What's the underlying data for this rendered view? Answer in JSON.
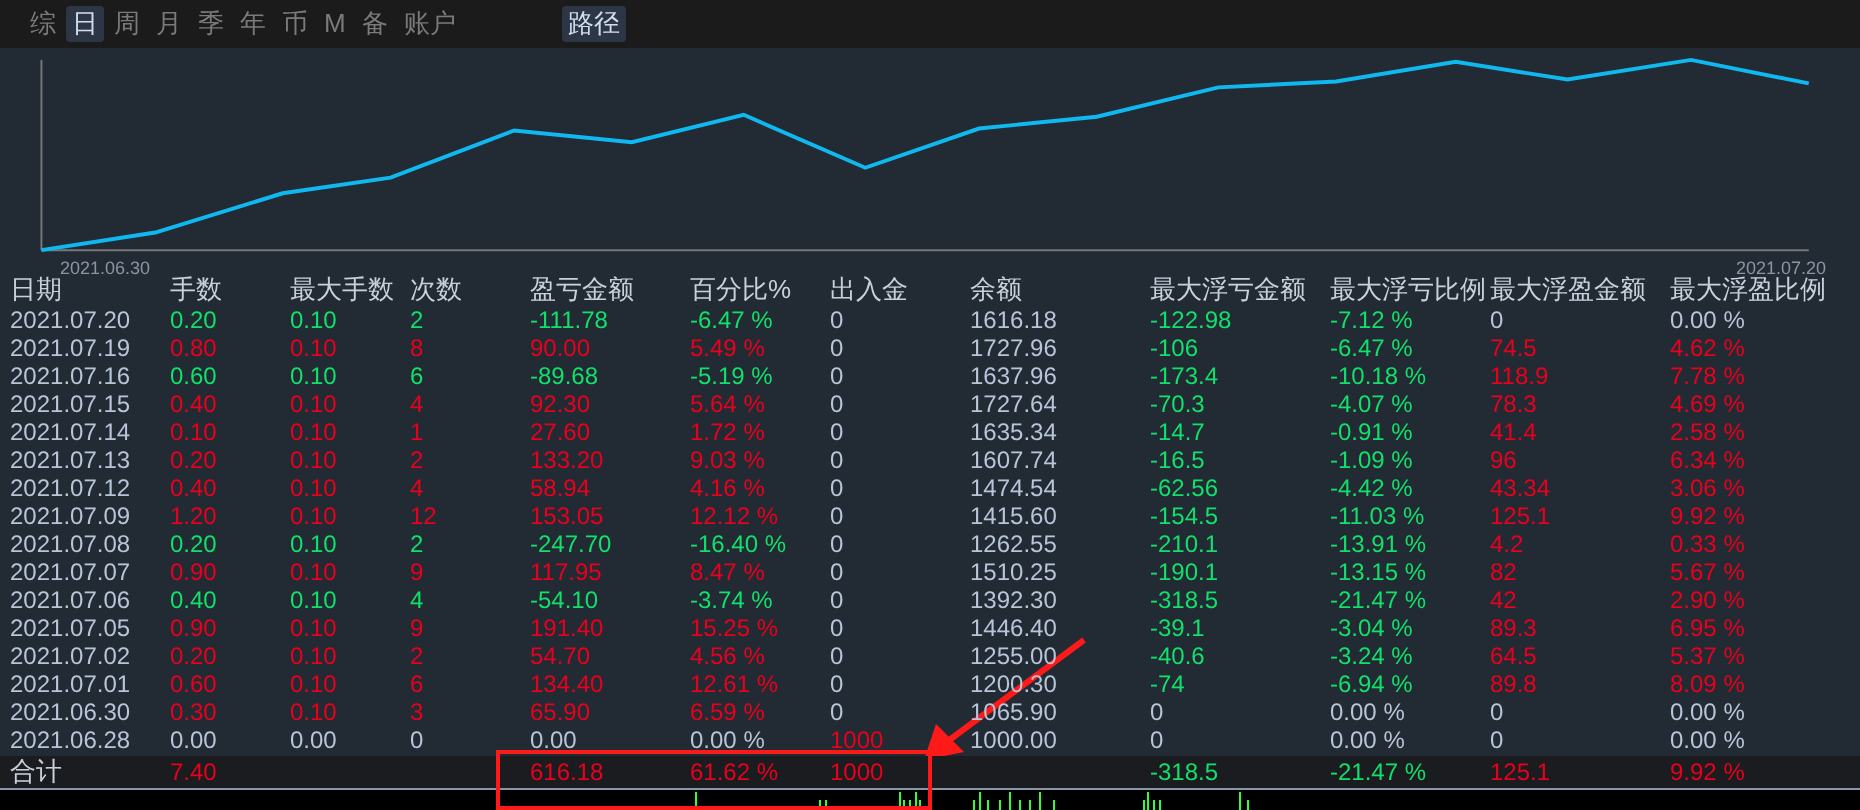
{
  "tabs": [
    {
      "label": "综",
      "selected": false
    },
    {
      "label": "日",
      "selected": true
    },
    {
      "label": "周",
      "selected": false
    },
    {
      "label": "月",
      "selected": false
    },
    {
      "label": "季",
      "selected": false
    },
    {
      "label": "年",
      "selected": false
    },
    {
      "label": "币",
      "selected": false
    },
    {
      "label": "M",
      "selected": false
    },
    {
      "label": "备",
      "selected": false
    },
    {
      "label": "账户",
      "selected": false
    }
  ],
  "path_button": {
    "label": "路径",
    "selected": true
  },
  "chart": {
    "start_label": "2021.06.30",
    "end_label": "2021.07.20"
  },
  "table": {
    "columns": [
      "日期",
      "手数",
      "最大手数",
      "次数",
      "盈亏金额",
      "百分比%",
      "出入金",
      "余额",
      "最大浮亏金额",
      "最大浮亏比例",
      "最大浮盈金额",
      "最大浮盈比例"
    ],
    "rows": [
      {
        "cells": [
          {
            "v": "2021.07.20",
            "color": "#b8c4d8"
          },
          {
            "v": "0.20",
            "color": "#12e06a"
          },
          {
            "v": "0.10",
            "color": "#12e06a"
          },
          {
            "v": "2",
            "color": "#12e06a"
          },
          {
            "v": "-111.78",
            "color": "#12e06a"
          },
          {
            "v": "-6.47 %",
            "color": "#12e06a"
          },
          {
            "v": "0",
            "color": "#b8c4d8"
          },
          {
            "v": "1616.18",
            "color": "#b8c4d8"
          },
          {
            "v": "-122.98",
            "color": "#12e06a"
          },
          {
            "v": "-7.12 %",
            "color": "#12e06a"
          },
          {
            "v": "0",
            "color": "#b8c4d8"
          },
          {
            "v": "0.00 %",
            "color": "#b8c4d8"
          }
        ]
      },
      {
        "cells": [
          {
            "v": "2021.07.19",
            "color": "#b8c4d8"
          },
          {
            "v": "0.80",
            "color": "#e8001c"
          },
          {
            "v": "0.10",
            "color": "#e8001c"
          },
          {
            "v": "8",
            "color": "#e8001c"
          },
          {
            "v": "90.00",
            "color": "#e8001c"
          },
          {
            "v": "5.49 %",
            "color": "#e8001c"
          },
          {
            "v": "0",
            "color": "#b8c4d8"
          },
          {
            "v": "1727.96",
            "color": "#b8c4d8"
          },
          {
            "v": "-106",
            "color": "#12e06a"
          },
          {
            "v": "-6.47 %",
            "color": "#12e06a"
          },
          {
            "v": "74.5",
            "color": "#e8001c"
          },
          {
            "v": "4.62 %",
            "color": "#e8001c"
          }
        ]
      },
      {
        "cells": [
          {
            "v": "2021.07.16",
            "color": "#b8c4d8"
          },
          {
            "v": "0.60",
            "color": "#12e06a"
          },
          {
            "v": "0.10",
            "color": "#12e06a"
          },
          {
            "v": "6",
            "color": "#12e06a"
          },
          {
            "v": "-89.68",
            "color": "#12e06a"
          },
          {
            "v": "-5.19 %",
            "color": "#12e06a"
          },
          {
            "v": "0",
            "color": "#b8c4d8"
          },
          {
            "v": "1637.96",
            "color": "#b8c4d8"
          },
          {
            "v": "-173.4",
            "color": "#12e06a"
          },
          {
            "v": "-10.18 %",
            "color": "#12e06a"
          },
          {
            "v": "118.9",
            "color": "#e8001c"
          },
          {
            "v": "7.78 %",
            "color": "#e8001c"
          }
        ]
      },
      {
        "cells": [
          {
            "v": "2021.07.15",
            "color": "#b8c4d8"
          },
          {
            "v": "0.40",
            "color": "#e8001c"
          },
          {
            "v": "0.10",
            "color": "#e8001c"
          },
          {
            "v": "4",
            "color": "#e8001c"
          },
          {
            "v": "92.30",
            "color": "#e8001c"
          },
          {
            "v": "5.64 %",
            "color": "#e8001c"
          },
          {
            "v": "0",
            "color": "#b8c4d8"
          },
          {
            "v": "1727.64",
            "color": "#b8c4d8"
          },
          {
            "v": "-70.3",
            "color": "#12e06a"
          },
          {
            "v": "-4.07 %",
            "color": "#12e06a"
          },
          {
            "v": "78.3",
            "color": "#e8001c"
          },
          {
            "v": "4.69 %",
            "color": "#e8001c"
          }
        ]
      },
      {
        "cells": [
          {
            "v": "2021.07.14",
            "color": "#b8c4d8"
          },
          {
            "v": "0.10",
            "color": "#e8001c"
          },
          {
            "v": "0.10",
            "color": "#e8001c"
          },
          {
            "v": "1",
            "color": "#e8001c"
          },
          {
            "v": "27.60",
            "color": "#e8001c"
          },
          {
            "v": "1.72 %",
            "color": "#e8001c"
          },
          {
            "v": "0",
            "color": "#b8c4d8"
          },
          {
            "v": "1635.34",
            "color": "#b8c4d8"
          },
          {
            "v": "-14.7",
            "color": "#12e06a"
          },
          {
            "v": "-0.91 %",
            "color": "#12e06a"
          },
          {
            "v": "41.4",
            "color": "#e8001c"
          },
          {
            "v": "2.58 %",
            "color": "#e8001c"
          }
        ]
      },
      {
        "cells": [
          {
            "v": "2021.07.13",
            "color": "#b8c4d8"
          },
          {
            "v": "0.20",
            "color": "#e8001c"
          },
          {
            "v": "0.10",
            "color": "#e8001c"
          },
          {
            "v": "2",
            "color": "#e8001c"
          },
          {
            "v": "133.20",
            "color": "#e8001c"
          },
          {
            "v": "9.03 %",
            "color": "#e8001c"
          },
          {
            "v": "0",
            "color": "#b8c4d8"
          },
          {
            "v": "1607.74",
            "color": "#b8c4d8"
          },
          {
            "v": "-16.5",
            "color": "#12e06a"
          },
          {
            "v": "-1.09 %",
            "color": "#12e06a"
          },
          {
            "v": "96",
            "color": "#e8001c"
          },
          {
            "v": "6.34 %",
            "color": "#e8001c"
          }
        ]
      },
      {
        "cells": [
          {
            "v": "2021.07.12",
            "color": "#b8c4d8"
          },
          {
            "v": "0.40",
            "color": "#e8001c"
          },
          {
            "v": "0.10",
            "color": "#e8001c"
          },
          {
            "v": "4",
            "color": "#e8001c"
          },
          {
            "v": "58.94",
            "color": "#e8001c"
          },
          {
            "v": "4.16 %",
            "color": "#e8001c"
          },
          {
            "v": "0",
            "color": "#b8c4d8"
          },
          {
            "v": "1474.54",
            "color": "#b8c4d8"
          },
          {
            "v": "-62.56",
            "color": "#12e06a"
          },
          {
            "v": "-4.42 %",
            "color": "#12e06a"
          },
          {
            "v": "43.34",
            "color": "#e8001c"
          },
          {
            "v": "3.06 %",
            "color": "#e8001c"
          }
        ]
      },
      {
        "cells": [
          {
            "v": "2021.07.09",
            "color": "#b8c4d8"
          },
          {
            "v": "1.20",
            "color": "#e8001c"
          },
          {
            "v": "0.10",
            "color": "#e8001c"
          },
          {
            "v": "12",
            "color": "#e8001c"
          },
          {
            "v": "153.05",
            "color": "#e8001c"
          },
          {
            "v": "12.12 %",
            "color": "#e8001c"
          },
          {
            "v": "0",
            "color": "#b8c4d8"
          },
          {
            "v": "1415.60",
            "color": "#b8c4d8"
          },
          {
            "v": "-154.5",
            "color": "#12e06a"
          },
          {
            "v": "-11.03 %",
            "color": "#12e06a"
          },
          {
            "v": "125.1",
            "color": "#e8001c"
          },
          {
            "v": "9.92 %",
            "color": "#e8001c"
          }
        ]
      },
      {
        "cells": [
          {
            "v": "2021.07.08",
            "color": "#b8c4d8"
          },
          {
            "v": "0.20",
            "color": "#12e06a"
          },
          {
            "v": "0.10",
            "color": "#12e06a"
          },
          {
            "v": "2",
            "color": "#12e06a"
          },
          {
            "v": "-247.70",
            "color": "#12e06a"
          },
          {
            "v": "-16.40 %",
            "color": "#12e06a"
          },
          {
            "v": "0",
            "color": "#b8c4d8"
          },
          {
            "v": "1262.55",
            "color": "#b8c4d8"
          },
          {
            "v": "-210.1",
            "color": "#12e06a"
          },
          {
            "v": "-13.91 %",
            "color": "#12e06a"
          },
          {
            "v": "4.2",
            "color": "#e8001c"
          },
          {
            "v": "0.33 %",
            "color": "#e8001c"
          }
        ]
      },
      {
        "cells": [
          {
            "v": "2021.07.07",
            "color": "#b8c4d8"
          },
          {
            "v": "0.90",
            "color": "#e8001c"
          },
          {
            "v": "0.10",
            "color": "#e8001c"
          },
          {
            "v": "9",
            "color": "#e8001c"
          },
          {
            "v": "117.95",
            "color": "#e8001c"
          },
          {
            "v": "8.47 %",
            "color": "#e8001c"
          },
          {
            "v": "0",
            "color": "#b8c4d8"
          },
          {
            "v": "1510.25",
            "color": "#b8c4d8"
          },
          {
            "v": "-190.1",
            "color": "#12e06a"
          },
          {
            "v": "-13.15 %",
            "color": "#12e06a"
          },
          {
            "v": "82",
            "color": "#e8001c"
          },
          {
            "v": "5.67 %",
            "color": "#e8001c"
          }
        ]
      },
      {
        "cells": [
          {
            "v": "2021.07.06",
            "color": "#b8c4d8"
          },
          {
            "v": "0.40",
            "color": "#12e06a"
          },
          {
            "v": "0.10",
            "color": "#12e06a"
          },
          {
            "v": "4",
            "color": "#12e06a"
          },
          {
            "v": "-54.10",
            "color": "#12e06a"
          },
          {
            "v": "-3.74 %",
            "color": "#12e06a"
          },
          {
            "v": "0",
            "color": "#b8c4d8"
          },
          {
            "v": "1392.30",
            "color": "#b8c4d8"
          },
          {
            "v": "-318.5",
            "color": "#12e06a"
          },
          {
            "v": "-21.47 %",
            "color": "#12e06a"
          },
          {
            "v": "42",
            "color": "#e8001c"
          },
          {
            "v": "2.90 %",
            "color": "#e8001c"
          }
        ]
      },
      {
        "cells": [
          {
            "v": "2021.07.05",
            "color": "#b8c4d8"
          },
          {
            "v": "0.90",
            "color": "#e8001c"
          },
          {
            "v": "0.10",
            "color": "#e8001c"
          },
          {
            "v": "9",
            "color": "#e8001c"
          },
          {
            "v": "191.40",
            "color": "#e8001c"
          },
          {
            "v": "15.25 %",
            "color": "#e8001c"
          },
          {
            "v": "0",
            "color": "#b8c4d8"
          },
          {
            "v": "1446.40",
            "color": "#b8c4d8"
          },
          {
            "v": "-39.1",
            "color": "#12e06a"
          },
          {
            "v": "-3.04 %",
            "color": "#12e06a"
          },
          {
            "v": "89.3",
            "color": "#e8001c"
          },
          {
            "v": "6.95 %",
            "color": "#e8001c"
          }
        ]
      },
      {
        "cells": [
          {
            "v": "2021.07.02",
            "color": "#b8c4d8"
          },
          {
            "v": "0.20",
            "color": "#e8001c"
          },
          {
            "v": "0.10",
            "color": "#e8001c"
          },
          {
            "v": "2",
            "color": "#e8001c"
          },
          {
            "v": "54.70",
            "color": "#e8001c"
          },
          {
            "v": "4.56 %",
            "color": "#e8001c"
          },
          {
            "v": "0",
            "color": "#b8c4d8"
          },
          {
            "v": "1255.00",
            "color": "#b8c4d8"
          },
          {
            "v": "-40.6",
            "color": "#12e06a"
          },
          {
            "v": "-3.24 %",
            "color": "#12e06a"
          },
          {
            "v": "64.5",
            "color": "#e8001c"
          },
          {
            "v": "5.37 %",
            "color": "#e8001c"
          }
        ]
      },
      {
        "cells": [
          {
            "v": "2021.07.01",
            "color": "#b8c4d8"
          },
          {
            "v": "0.60",
            "color": "#e8001c"
          },
          {
            "v": "0.10",
            "color": "#e8001c"
          },
          {
            "v": "6",
            "color": "#e8001c"
          },
          {
            "v": "134.40",
            "color": "#e8001c"
          },
          {
            "v": "12.61 %",
            "color": "#e8001c"
          },
          {
            "v": "0",
            "color": "#b8c4d8"
          },
          {
            "v": "1200.30",
            "color": "#b8c4d8"
          },
          {
            "v": "-74",
            "color": "#12e06a"
          },
          {
            "v": "-6.94 %",
            "color": "#12e06a"
          },
          {
            "v": "89.8",
            "color": "#e8001c"
          },
          {
            "v": "8.09 %",
            "color": "#e8001c"
          }
        ]
      },
      {
        "cells": [
          {
            "v": "2021.06.30",
            "color": "#b8c4d8"
          },
          {
            "v": "0.30",
            "color": "#e8001c"
          },
          {
            "v": "0.10",
            "color": "#e8001c"
          },
          {
            "v": "3",
            "color": "#e8001c"
          },
          {
            "v": "65.90",
            "color": "#e8001c"
          },
          {
            "v": "6.59 %",
            "color": "#e8001c"
          },
          {
            "v": "0",
            "color": "#b8c4d8"
          },
          {
            "v": "1065.90",
            "color": "#b8c4d8"
          },
          {
            "v": "0",
            "color": "#b8c4d8"
          },
          {
            "v": "0.00 %",
            "color": "#b8c4d8"
          },
          {
            "v": "0",
            "color": "#b8c4d8"
          },
          {
            "v": "0.00 %",
            "color": "#b8c4d8"
          }
        ]
      },
      {
        "cells": [
          {
            "v": "2021.06.28",
            "color": "#b8c4d8"
          },
          {
            "v": "0.00",
            "color": "#b8c4d8"
          },
          {
            "v": "0.00",
            "color": "#b8c4d8"
          },
          {
            "v": "0",
            "color": "#b8c4d8"
          },
          {
            "v": "0.00",
            "color": "#b8c4d8"
          },
          {
            "v": "0.00 %",
            "color": "#b8c4d8"
          },
          {
            "v": "1000",
            "color": "#e8001c"
          },
          {
            "v": "1000.00",
            "color": "#b8c4d8"
          },
          {
            "v": "0",
            "color": "#b8c4d8"
          },
          {
            "v": "0.00 %",
            "color": "#b8c4d8"
          },
          {
            "v": "0",
            "color": "#b8c4d8"
          },
          {
            "v": "0.00 %",
            "color": "#b8c4d8"
          }
        ]
      }
    ],
    "total": {
      "label": "合计",
      "cells": [
        {
          "v": "7.40",
          "color": "#e8001c"
        },
        null,
        null,
        {
          "v": "616.18",
          "color": "#e8001c"
        },
        {
          "v": "61.62 %",
          "color": "#e8001c"
        },
        {
          "v": "1000",
          "color": "#e8001c"
        },
        null,
        {
          "v": "-318.5",
          "color": "#12e06a"
        },
        {
          "v": "-21.47 %",
          "color": "#12e06a"
        },
        {
          "v": "125.1",
          "color": "#e8001c"
        },
        {
          "v": "9.92 %",
          "color": "#e8001c"
        }
      ]
    }
  }
}
